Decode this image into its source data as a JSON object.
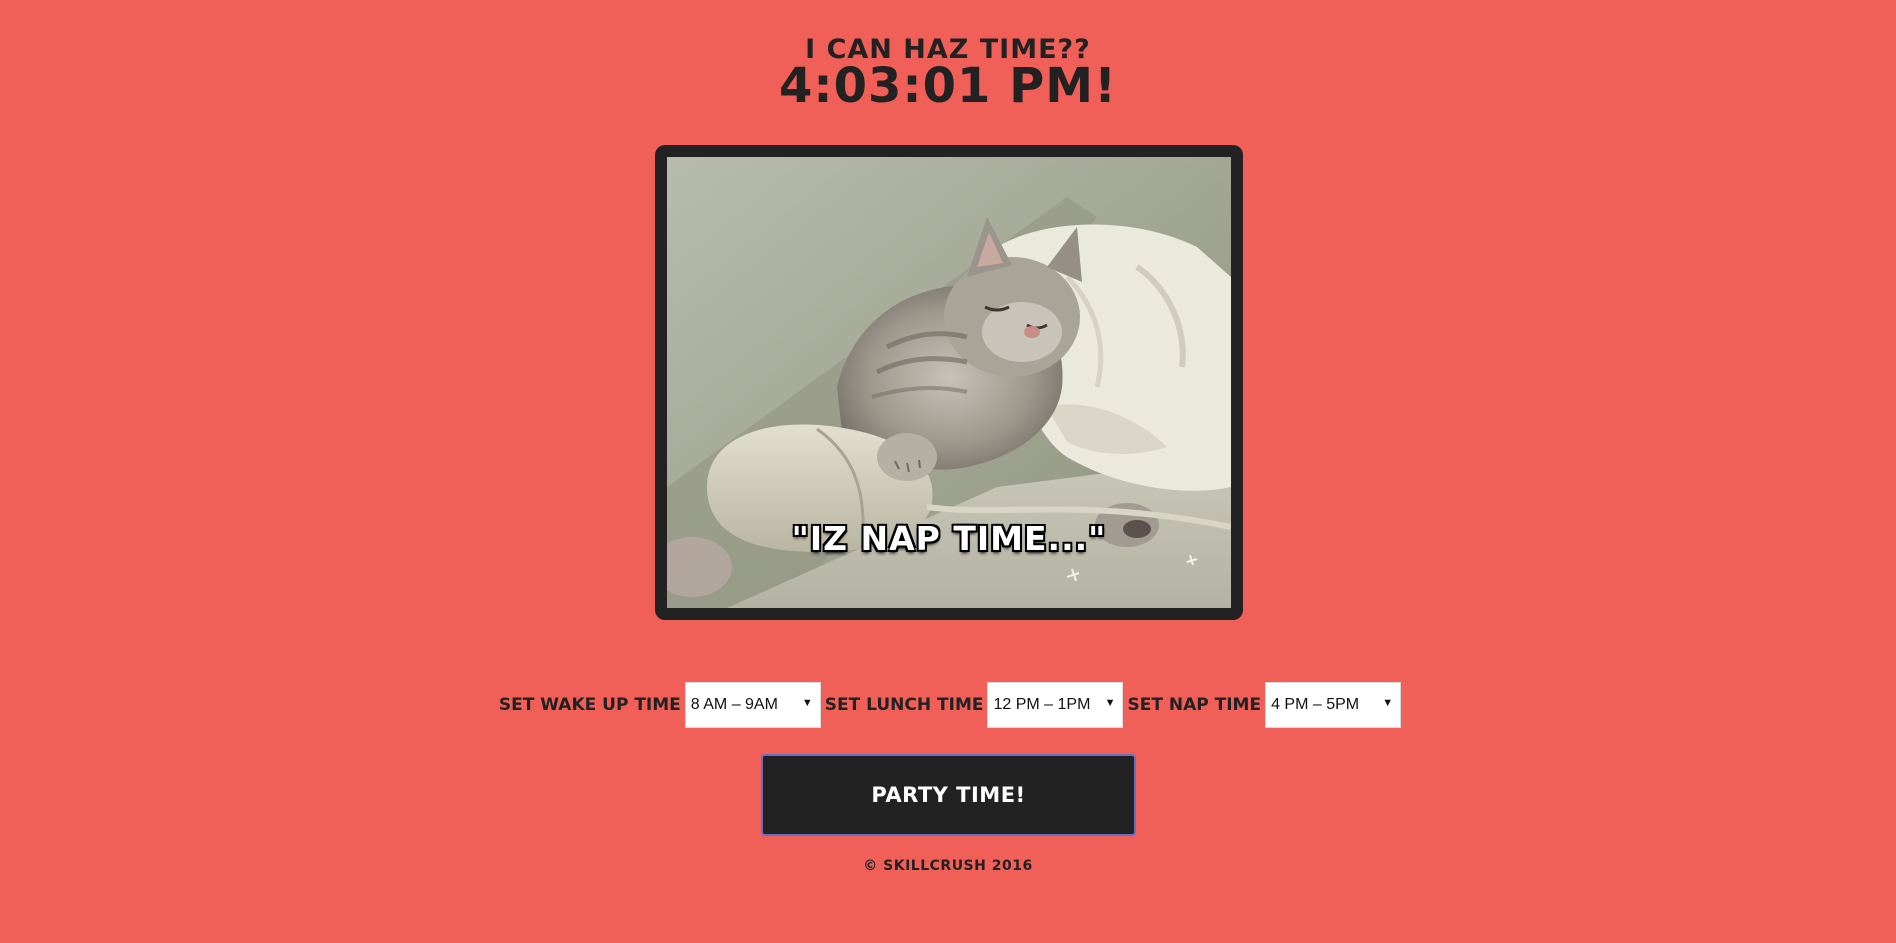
{
  "header": {
    "title": "I can haz time??",
    "clock": "4:03:01 PM!"
  },
  "image": {
    "caption": "\"IZ NAP TIME...\"",
    "subject": "sleeping-kitten-photo"
  },
  "controls": [
    {
      "label": "Set Wake Up Time",
      "value": "8 AM – 9AM"
    },
    {
      "label": "Set Lunch Time",
      "value": "12 PM – 1PM"
    },
    {
      "label": "Set Nap Time",
      "value": "4 PM – 5PM"
    }
  ],
  "party_button": {
    "label": "Party Time!"
  },
  "footer": {
    "copyright": "© Skillcrush 2016"
  },
  "colors": {
    "background": "#f15f59",
    "dark": "#222222",
    "button_border": "#6a6ec0",
    "caption_text": "#ffffff"
  }
}
